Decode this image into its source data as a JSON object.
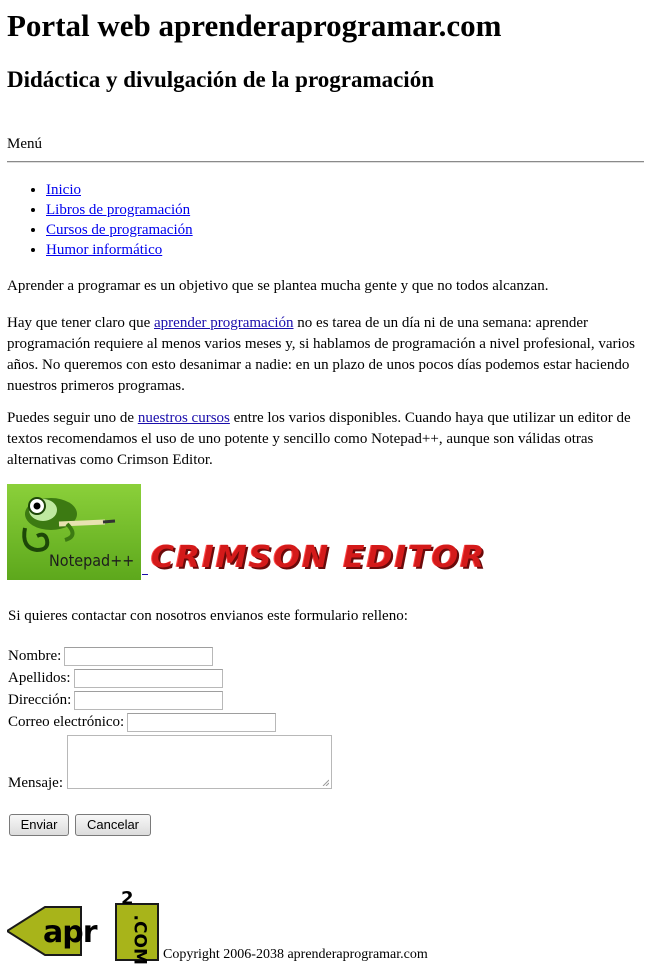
{
  "header": {
    "title": "Portal web aprenderaprogramar.com",
    "subtitle": "Didáctica y divulgación de la programación"
  },
  "menu": {
    "label": "Menú",
    "items": [
      {
        "label": "Inicio"
      },
      {
        "label": "Libros de programación"
      },
      {
        "label": "Cursos de programación"
      },
      {
        "label": "Humor informático"
      }
    ]
  },
  "content": {
    "p1": "Aprender a programar es un objetivo que se plantea mucha gente y que no todos alcanzan.",
    "p2_before": "Hay que tener claro que ",
    "p2_link": "aprender programación",
    "p2_after": " no es tarea de un día ni de una semana: aprender programación requiere al menos varios meses y, si hablamos de programación a nivel profesional, varios años. No queremos con esto desanimar a nadie: en un plazo de unos pocos días podemos estar haciendo nuestros primeros programas.",
    "p3_before": "Puedes seguir uno de ",
    "p3_link": "nuestros cursos",
    "p3_after": " entre los varios disponibles. Cuando haya que utilizar un editor de textos recomendamos el uso de uno potente y sencillo como Notepad++, aunque son válidas otras alternativas como Crimson Editor."
  },
  "images": {
    "notepad_text": "Notepad++",
    "crimson_text": "CRIMSON EDITOR",
    "brand_red": "#d41a1a",
    "notepad_green": "#7ac231"
  },
  "form": {
    "intro": "Si quieres contactar con nosotros envianos este formulario relleno:",
    "fields": [
      {
        "label": "Nombre:",
        "value": ""
      },
      {
        "label": "Apellidos:",
        "value": ""
      },
      {
        "label": "Dirección:",
        "value": ""
      },
      {
        "label": "Correo electrónico:",
        "value": ""
      }
    ],
    "message_label": "Mensaje:",
    "message_value": "",
    "submit_label": "Enviar",
    "cancel_label": "Cancelar"
  },
  "footer": {
    "logo_text_main": "apr",
    "logo_text_sup": "2",
    "logo_text_side": ".COM",
    "logo_color": "#a8b41a",
    "copyright": "Copyright 2006-2038 aprenderaprogramar.com"
  }
}
